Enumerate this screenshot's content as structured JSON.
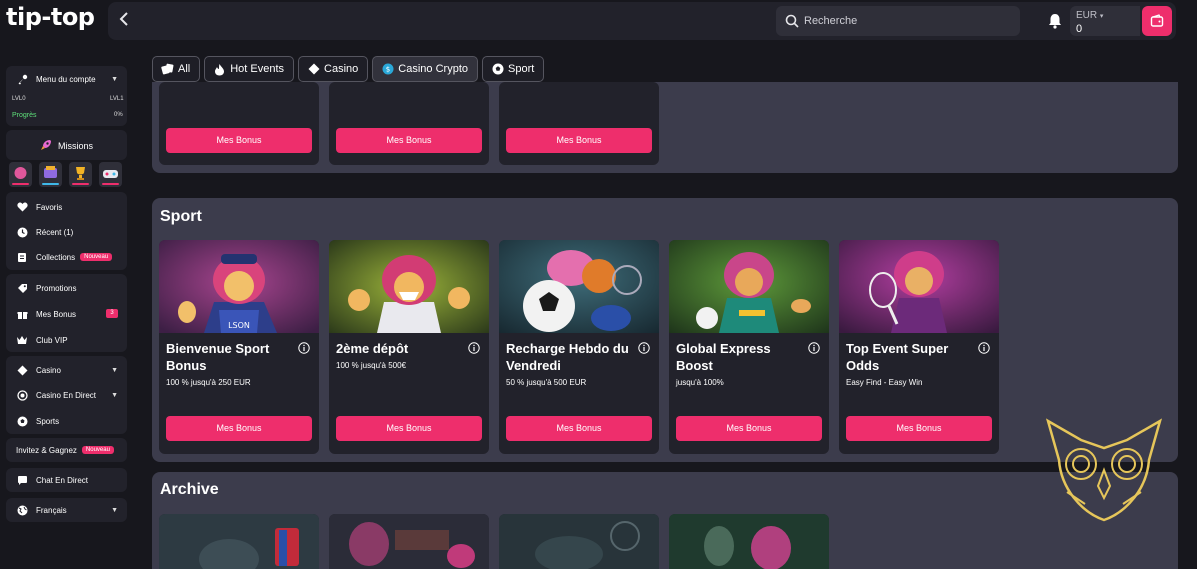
{
  "header": {
    "logo_text": "tip-top",
    "back_icon": "chevron-left-icon",
    "search_placeholder": "Recherche",
    "currency": "EUR",
    "balance": "0",
    "accent_color": "#ee2e6c"
  },
  "sidebar": {
    "account_menu": "Menu du compte",
    "level_left": "LVL0",
    "level_right": "LVL1",
    "progress_label": "Progrès",
    "progress_value": "0%",
    "progress_fraction": 0.0,
    "missions": "Missions",
    "items": [
      {
        "label": "Favoris",
        "icon": "heart-icon"
      },
      {
        "label": "Récent (1)",
        "icon": "clock-icon"
      },
      {
        "label": "Collections",
        "icon": "collections-icon",
        "badge": "Nouveau"
      },
      {
        "label": "Promotions",
        "icon": "tag-icon"
      },
      {
        "label": "Mes Bonus",
        "icon": "gift-icon",
        "count": "3"
      },
      {
        "label": "Club VIP",
        "icon": "crown-icon"
      },
      {
        "label": "Casino",
        "icon": "diamond-icon"
      },
      {
        "label": "Casino En Direct",
        "icon": "live-icon"
      },
      {
        "label": "Sports",
        "icon": "soccer-ball-icon"
      },
      {
        "label": "Invitez & Gagnez",
        "badge": "Nouveau"
      },
      {
        "label": "Chat En Direct",
        "icon": "chat-icon"
      },
      {
        "label": "Français",
        "icon": "globe-icon"
      }
    ]
  },
  "filters": [
    {
      "label": "All",
      "icon": "cards-icon"
    },
    {
      "label": "Hot Events",
      "icon": "flame-icon"
    },
    {
      "label": "Casino",
      "icon": "diamond-icon"
    },
    {
      "label": "Casino Crypto",
      "icon": "crypto-coin-icon",
      "active": true
    },
    {
      "label": "Sport",
      "icon": "soccer-ball-icon"
    }
  ],
  "top_section": {
    "buttons": [
      "Mes Bonus",
      "Mes Bonus",
      "Mes Bonus"
    ]
  },
  "sport_section": {
    "title": "Sport",
    "cards": [
      {
        "title": "Bienvenue Sport Bonus",
        "desc": "100 % jusqu'à 250 EUR",
        "button": "Mes Bonus"
      },
      {
        "title": "2ème dépôt",
        "desc": "100 % jusqu'à 500€",
        "button": "Mes Bonus"
      },
      {
        "title": "Recharge Hebdo du Vendredi",
        "desc": "50 % jusqu'à 500 EUR",
        "button": "Mes Bonus"
      },
      {
        "title": "Global Express Boost",
        "desc": "jusqu'à 100%",
        "button": "Mes Bonus"
      },
      {
        "title": "Top Event Super Odds",
        "desc": "Easy Find - Easy Win",
        "button": "Mes Bonus"
      }
    ]
  },
  "archive_section": {
    "title": "Archive"
  }
}
